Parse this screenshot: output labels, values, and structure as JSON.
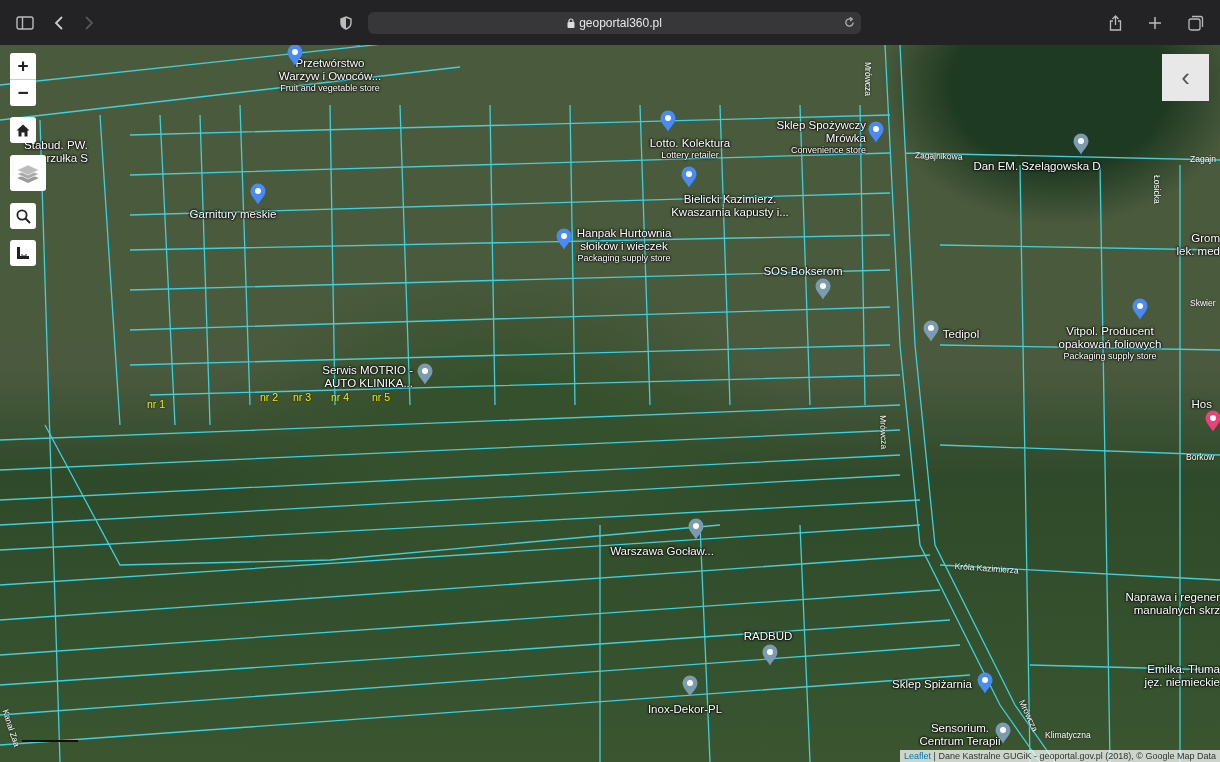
{
  "browser": {
    "url": "geoportal360.pl",
    "forward_disabled": true
  },
  "map_controls": {
    "zoom_in": "+",
    "zoom_out": "−",
    "panel_toggle": "‹"
  },
  "places": [
    {
      "lines": [
        "Przetwórstwo",
        "Warzyw i Owoców..."
      ],
      "category": "Fruit and vegetable store",
      "color": "#4a8af4"
    },
    {
      "lines": [
        "Stabud. PW.",
        "rzułka S"
      ]
    },
    {
      "lines": [
        "Garnitury meskie"
      ],
      "color": "#4a8af4"
    },
    {
      "lines": [
        "Lotto. Kolektura"
      ],
      "category": "Lottery retailer",
      "color": "#4a8af4"
    },
    {
      "lines": [
        "Sklep Spożywczy",
        "Mrówka"
      ],
      "category": "Convenience store",
      "color": "#4a8af4"
    },
    {
      "lines": [
        "Bielicki Kazimierz.",
        "Kwaszarnia kapusty i..."
      ],
      "color": "#4a8af4"
    },
    {
      "lines": [
        "Hanpak Hurtownia",
        "słoików i wieczek"
      ],
      "category": "Packaging supply store",
      "color": "#4a8af4"
    },
    {
      "lines": [
        "SOS Bokserom"
      ],
      "color": "#7b9bb0"
    },
    {
      "lines": [
        "Serwis MOTRIO -",
        "AUTO KLINIKA..."
      ],
      "color": "#7b9bb0"
    },
    {
      "lines": [
        "Dan EM. Szelągowska D"
      ],
      "color": "#7b9bb0"
    },
    {
      "lines": [
        "Tedipol"
      ],
      "color": "#7b9bb0"
    },
    {
      "lines": [
        "Vitpol. Producent",
        "opakowań foliowych"
      ],
      "category": "Packaging supply store",
      "color": "#4a8af4"
    },
    {
      "lines": [
        "Grom",
        "lek. med"
      ]
    },
    {
      "lines": [
        "Hos"
      ],
      "color": "#ec407a"
    },
    {
      "lines": [
        "Warszawa Gocław..."
      ],
      "color": "#7b9bb0"
    },
    {
      "lines": [
        "Naprawa i regener",
        "manualnych skrz"
      ]
    },
    {
      "lines": [
        "RADBUD"
      ],
      "color": "#7b9bb0"
    },
    {
      "lines": [
        "Sklep Spiżarnia"
      ],
      "color": "#4a8af4"
    },
    {
      "lines": [
        "Emilka. Tłuma",
        "jęz. niemieckie"
      ]
    },
    {
      "lines": [
        "Inox-Dekor-PL"
      ],
      "color": "#7b9bb0"
    },
    {
      "lines": [
        "Sensorium.",
        "Centrum Terapii"
      ],
      "color": "#7b9bb0"
    }
  ],
  "parcel_labels": [
    "nr 1",
    "nr 2",
    "nr 3",
    "nr 4",
    "nr 5"
  ],
  "streets": [
    "Mrówcza",
    "Zagajnikowa",
    "Zagajn",
    "Łosicka",
    "Skwier",
    "Mrówcza",
    "Borkow",
    "Króla Kazimierza",
    "Klimatyczna",
    "Mrówcza",
    "Kanał Zaa"
  ],
  "attribution": {
    "link": "Leaflet",
    "text": "| Dane Kastralne GUGiK - geoportal.gov.pl (2018), © Google Map Data"
  }
}
